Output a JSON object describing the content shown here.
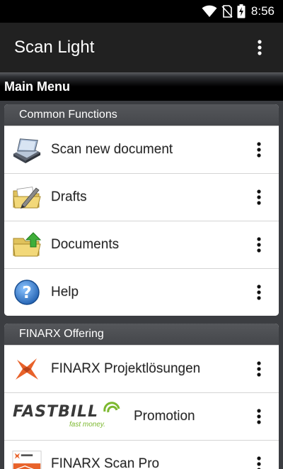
{
  "status_bar": {
    "time": "8:56",
    "icons": [
      "wifi-icon",
      "no-sim-icon",
      "battery-charging-icon"
    ]
  },
  "app_bar": {
    "title": "Scan Light",
    "overflow_icon": "more-vertical-icon"
  },
  "main_menu": {
    "label": "Main Menu"
  },
  "sections": [
    {
      "title": "Common Functions",
      "items": [
        {
          "label": "Scan new document",
          "icon": "scanner-icon"
        },
        {
          "label": "Drafts",
          "icon": "drafts-folder-icon"
        },
        {
          "label": "Documents",
          "icon": "documents-folder-icon"
        },
        {
          "label": "Help",
          "icon": "help-icon"
        }
      ]
    },
    {
      "title": "FINARX Offering",
      "items": [
        {
          "label": "FINARX Projektlösungen",
          "icon": "finarx-logo-icon"
        },
        {
          "label": "Promotion",
          "icon": "fastbill-logo"
        },
        {
          "label": "FINARX Scan Pro",
          "icon": "finarx-scan-pro-icon"
        }
      ]
    }
  ],
  "fastbill": {
    "word_a": "FASTBILL",
    "tagline": "fast money."
  },
  "colors": {
    "status_bar": "#000000",
    "app_bar": "#212121",
    "background": "#3b3d41",
    "section_header": "#4a4b4f",
    "fastbill_green": "#7cb82f",
    "help_blue": "#2e78c8"
  }
}
